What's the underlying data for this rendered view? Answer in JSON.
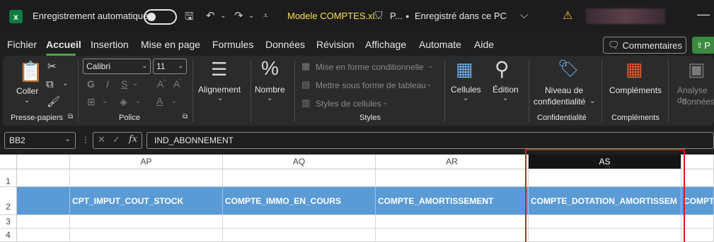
{
  "titlebar": {
    "autosave_label": "Enregistrement automatique",
    "filename": "Modele COMPTES.xl...",
    "sensitivity": "P...",
    "saved_status": "Enregistré dans ce PC",
    "saved_chevron": "⌵"
  },
  "menu": {
    "tabs": [
      "Fichier",
      "Accueil",
      "Insertion",
      "Mise en page",
      "Formules",
      "Données",
      "Révision",
      "Affichage",
      "Automate",
      "Aide"
    ],
    "active_tab": "Accueil",
    "comments_button": "Commentaires",
    "share_button": "P"
  },
  "ribbon": {
    "paste_label": "Coller",
    "clipboard_group": "Presse-papiers",
    "font_name": "Calibri",
    "font_size": "11",
    "font_group": "Police",
    "alignment_label": "Alignement",
    "number_label": "Nombre",
    "conditional_format": "Mise en forme conditionnelle",
    "format_as_table": "Mettre sous forme de tableau",
    "cell_styles": "Styles de cellules",
    "styles_group": "Styles",
    "cells_label": "Cellules",
    "editing_label": "Édition",
    "sensitivity_line1": "Niveau de",
    "sensitivity_line2": "confidentialité",
    "sensitivity_group": "Confidentialité",
    "addins_label": "Compléments",
    "addins_group": "Compléments",
    "analyze_line1": "Analyse de",
    "analyze_line2": "données"
  },
  "formula_bar": {
    "name_box": "BB2",
    "formula": "IND_ABONNEMENT"
  },
  "grid": {
    "columns": [
      "AP",
      "AQ",
      "AR",
      "AS"
    ],
    "selected_column": "AS",
    "rows": [
      "1",
      "2",
      "3",
      "4"
    ],
    "row2_values": [
      "CPT_IMPUT_COUT_STOCK",
      "COMPTE_IMMO_EN_COURS",
      "COMPTE_AMORTISSEMENT",
      "COMPTE_DOTATION_AMORTISSEM",
      "COMPT"
    ]
  },
  "colors": {
    "accent": "#4ea24a",
    "header_fill": "#5b9bd5",
    "highlight_box": "#d0211e",
    "filename": "#f5e04f"
  }
}
